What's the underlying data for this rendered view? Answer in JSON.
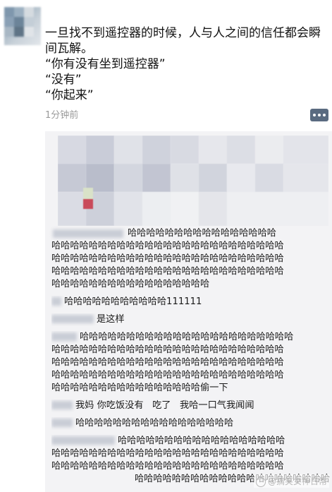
{
  "post": {
    "text_lines": [
      "一旦找不到遥控器的时候，人与人之间的信任都会瞬",
      "间瓦解。",
      "“你有没有坐到遥控器”",
      "“没有”",
      "“你起来”"
    ],
    "time": "1分钟前"
  },
  "comments": [
    {
      "lines": [
        "哈哈哈哈哈哈哈哈哈哈哈哈哈哈哈哈",
        "哈哈哈哈哈哈哈哈哈哈哈哈哈哈哈哈哈哈哈哈哈哈哈哈哈",
        "哈哈哈哈哈哈哈哈哈哈哈哈哈哈哈哈哈哈哈哈哈哈哈哈哈",
        "哈哈哈哈哈哈哈哈哈哈哈哈哈哈哈哈哈哈哈哈哈哈哈哈哈",
        "哈哈哈哈哈哈哈哈哈哈哈哈哈哈哈哈哈"
      ]
    },
    {
      "lines": [
        "哈哈哈哈哈哈哈哈哈哈哈111111"
      ]
    },
    {
      "lines": [
        "是这样"
      ]
    },
    {
      "lines": [
        "哈哈哈哈哈哈哈哈哈哈哈哈哈哈哈哈哈哈哈哈哈哈哈",
        "哈哈哈哈哈哈哈哈哈哈哈哈哈哈哈哈哈哈哈哈哈哈哈哈哈",
        "哈哈哈哈哈哈哈哈哈哈哈哈哈哈哈哈哈哈哈哈哈哈哈哈哈",
        "哈哈哈哈哈哈哈哈哈哈哈哈哈哈哈哈哈哈哈哈哈哈哈哈哈",
        "哈哈哈哈哈哈哈哈哈哈哈哈哈哈哈哈偷一下"
      ]
    },
    {
      "lines": [
        "我妈 你吃饭没有   吃了   我哈一口气我闻闻"
      ]
    },
    {
      "lines": [
        "哈哈哈哈哈哈哈哈哈哈哈哈哈哈哈哈哈"
      ]
    },
    {
      "lines": [
        "哈哈哈哈哈哈哈哈哈哈哈哈哈哈哈哈哈哈",
        "哈哈哈哈哈哈哈哈哈哈哈哈哈哈哈哈哈哈哈哈哈哈哈哈哈",
        "哈哈哈哈哈哈哈哈哈哈哈哈哈哈哈哈哈哈哈哈哈哈哈哈哈",
        "哈哈哈哈哈哈哈哈哈哈哈哈哈哈哈哈哈哈哈哈哈哈哈哈哈"
      ]
    }
  ],
  "watermark": "@搞笑女神日常",
  "colors": {
    "comment_bg": "#f3f3f5",
    "more_button": "#5a6b80",
    "time": "#9a9a9a"
  }
}
